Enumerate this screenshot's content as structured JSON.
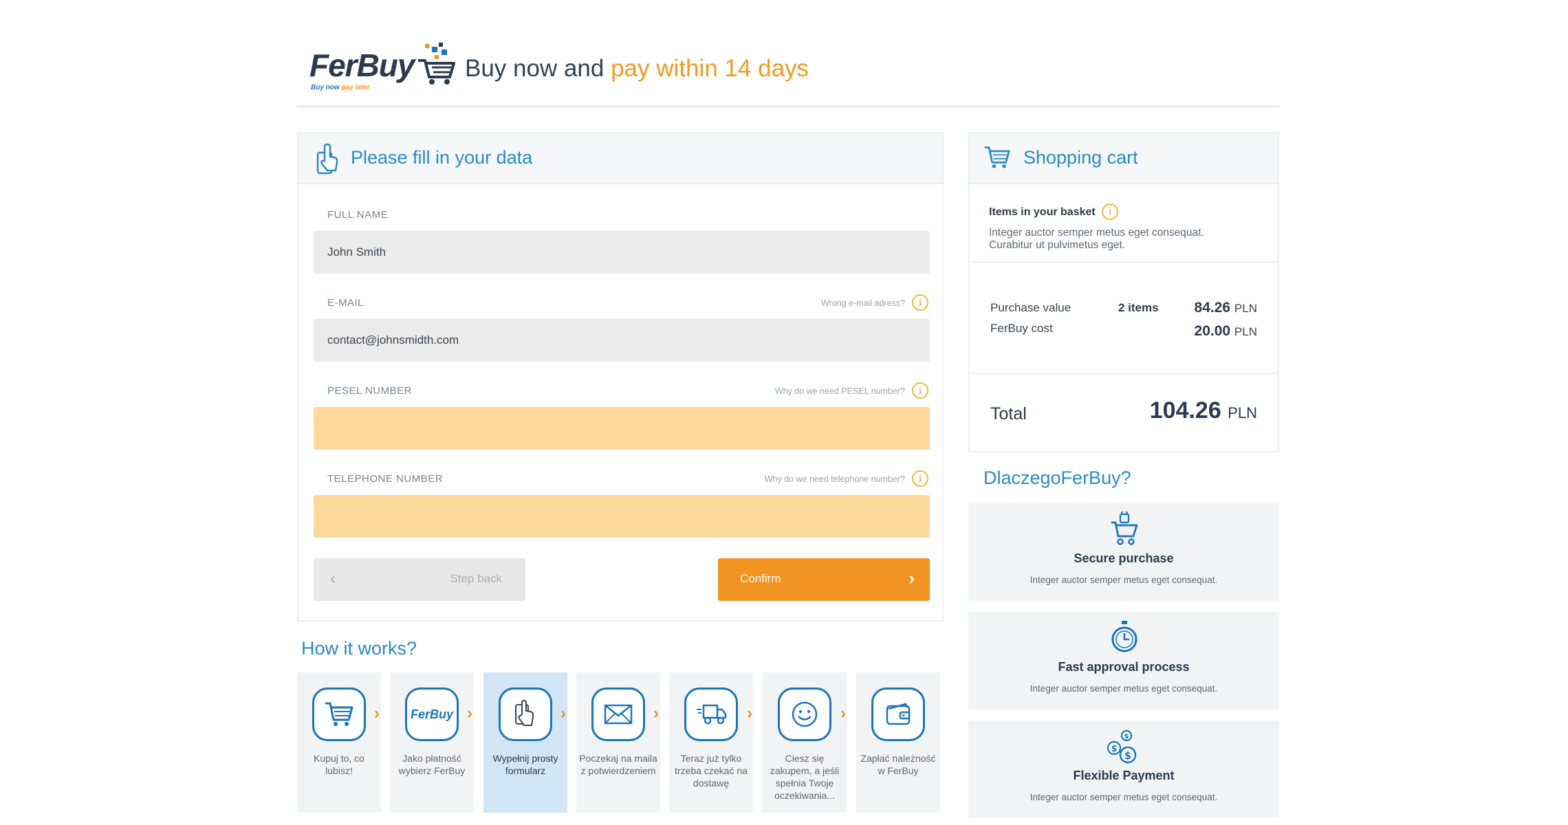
{
  "header": {
    "logo_text": "FerBuy",
    "logo_tagline_start": "Buy now ",
    "logo_tagline_end": "pay later",
    "tagline_start": "Buy now and ",
    "tagline_highlight": "pay within 14 days"
  },
  "form": {
    "title": "Please fill in your data",
    "fields": [
      {
        "label": "FULL NAME",
        "value": "John Smith",
        "hint": ""
      },
      {
        "label": "E-MAIL",
        "value": "contact@johnsmidth.com",
        "hint": "Wrong e-mail adress?"
      },
      {
        "label": "PESEL NUMBER",
        "value": "",
        "hint": "Why do we need PESEL number?"
      },
      {
        "label": "TELEPHONE NUMBER",
        "value": "",
        "hint": "Why do we need telephone number?"
      }
    ],
    "info_glyph": "i",
    "back_label": "Step back",
    "confirm_label": "Confirm"
  },
  "how": {
    "title": "How it works?",
    "steps": [
      {
        "icon": "cart-icon",
        "text": "Kupuj to, co lubisz!"
      },
      {
        "icon": "ferbuy-logo-icon",
        "text": "Jako płatność wybierz FerBuy",
        "icon_text": "FerBuy"
      },
      {
        "icon": "hand-pointer-icon",
        "text": "Wypełnij prosty formularz"
      },
      {
        "icon": "envelope-icon",
        "text": "Poczekaj na maila z potwierdzeniem"
      },
      {
        "icon": "delivery-truck-icon",
        "text": "Teraz już tylko trzeba czekać na dostawę"
      },
      {
        "icon": "smiley-icon",
        "text": "Ciesz się zakupem, a jeśli spełnia Twoje oczekiwania..."
      },
      {
        "icon": "wallet-icon",
        "text": "Zapłać należność w FerBuy"
      }
    ],
    "active_step": 2
  },
  "cart": {
    "title": "Shopping cart",
    "basket_title": "Items in your basket",
    "basket_desc": "Integer auctor semper metus eget consequat. Curabitur ut pulvimetus eget.",
    "purchase_label": "Purchase value",
    "items_count": "2 items",
    "purchase_value": "84.26",
    "ferbuy_cost_label": "FerBuy cost",
    "ferbuy_cost_value": "20.00",
    "currency": "PLN",
    "total_label": "Total",
    "total_value": "104.26"
  },
  "why": {
    "title": "DlaczegoFerBuy?",
    "features": [
      {
        "icon": "secure-cart-icon",
        "name": "Secure purchase",
        "desc": "Integer auctor semper metus eget consequat."
      },
      {
        "icon": "stopwatch-icon",
        "name": "Fast approval process",
        "desc": "Integer auctor semper metus eget consequat."
      },
      {
        "icon": "coins-icon",
        "name": "Flexible Payment",
        "desc": "Integer auctor semper metus eget consequat."
      }
    ]
  },
  "colors": {
    "accent_blue": "#2a8ac8",
    "accent_orange": "#f39422",
    "required_field": "#fcd89b"
  }
}
